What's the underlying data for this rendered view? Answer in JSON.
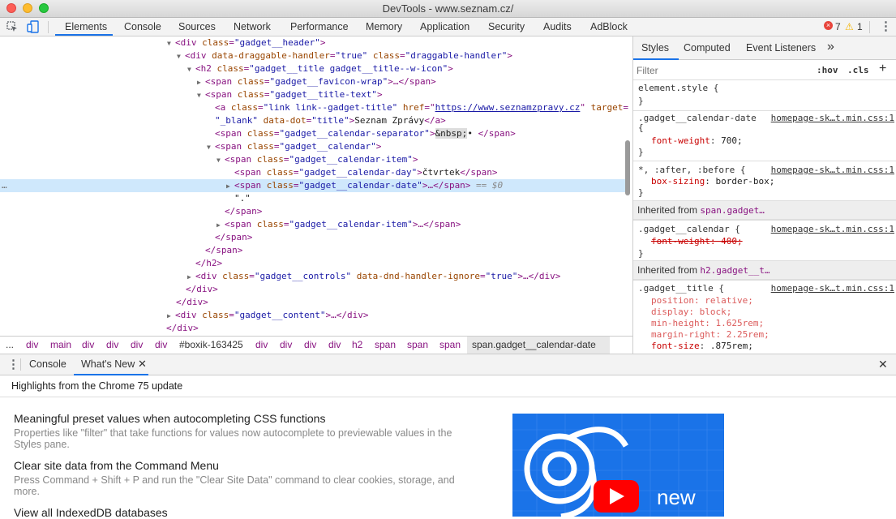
{
  "window": {
    "title": "DevTools - www.seznam.cz/"
  },
  "tabs": [
    "Elements",
    "Console",
    "Sources",
    "Network",
    "Performance",
    "Memory",
    "Application",
    "Security",
    "Audits",
    "AdBlock"
  ],
  "status": {
    "errors": "7",
    "warnings": "1"
  },
  "dom": {
    "l1": {
      "tag": "<div ",
      "a1": "class",
      "v1": "\"gadget__header\"",
      "end": ">"
    },
    "l2": {
      "tag": "<div ",
      "a1": "data-draggable-handler",
      "v1": "\"true\"",
      "a2": "class",
      "v2": "\"draggable-handler\"",
      "end": ">"
    },
    "l3": {
      "tag": "<h2 ",
      "a1": "class",
      "v1": "\"gadget__title gadget__title--w-icon\"",
      "end": ">"
    },
    "l4": {
      "tag": "<span ",
      "a1": "class",
      "v1": "\"gadget__favicon-wrap\"",
      "end": ">…</span>"
    },
    "l5": {
      "tag": "<span ",
      "a1": "class",
      "v1": "\"gadget__title-text\"",
      "end": ">"
    },
    "l6": {
      "tag": "<a ",
      "a1": "class",
      "v1": "\"link link--gadget-title\"",
      "a2": "href",
      "v2": "https://www.seznamzpravy.cz",
      "a3": "target",
      "v3": "\"_blank\"",
      "a4": "data-dot",
      "v4": "\"title\"",
      "text": "Seznam Zprávy",
      "end": "</a>"
    },
    "l8": {
      "tag": "<span ",
      "a1": "class",
      "v1": "\"gadget__calendar-separator\"",
      "entity": "&nbsp;",
      "text": "• ",
      "end": "</span>"
    },
    "l9": {
      "tag": "<span ",
      "a1": "class",
      "v1": "\"gadget__calendar\"",
      "end": ">"
    },
    "l10": {
      "tag": "<span ",
      "a1": "class",
      "v1": "\"gadget__calendar-item\"",
      "end": ">"
    },
    "l11": {
      "tag": "<span ",
      "a1": "class",
      "v1": "\"gadget__calendar-day\"",
      "text": "čtvrtek",
      "end": "</span>"
    },
    "l12": {
      "tag": "<span ",
      "a1": "class",
      "v1": "\"gadget__calendar-date\"",
      "end": ">…</span>",
      "eq": " == $0"
    },
    "l13": {
      "text": "\".\""
    },
    "l14": {
      "end": "</span>"
    },
    "l15": {
      "tag": "<span ",
      "a1": "class",
      "v1": "\"gadget__calendar-item\"",
      "end": ">…</span>"
    },
    "l16": {
      "end": "</span>"
    },
    "l17": {
      "end": "</span>"
    },
    "l18": {
      "end": "</h2>"
    },
    "l19": {
      "tag": "<div ",
      "a1": "class",
      "v1": "\"gadget__controls\"",
      "a2": "data-dnd-handler-ignore",
      "v2": "\"true\"",
      "end": ">…</div>"
    },
    "l20": {
      "end": "</div>"
    },
    "l21": {
      "end": "</div>"
    },
    "l22": {
      "tag": "<div ",
      "a1": "class",
      "v1": "\"gadget__content\"",
      "end": ">…</div>"
    },
    "l23": {
      "end": "</div>"
    }
  },
  "breadcrumbs": [
    "...",
    "div",
    "main",
    "div",
    "div",
    "div",
    "div",
    "#boxik-163425",
    "div",
    "div",
    "div",
    "div",
    "h2",
    "span",
    "span",
    "span",
    "span.gadget__calendar-date"
  ],
  "styles": {
    "tabs": [
      "Styles",
      "Computed",
      "Event Listeners",
      "»"
    ],
    "filter_placeholder": "Filter",
    "hov": ":hov",
    "cls": ".cls",
    "add": "+",
    "element_style": "element.style {",
    "close": "}",
    "r1_sel": ".gadget__calendar-date",
    "r1_src": "homepage-sk…t.min.css:1",
    "r1_prop": "font-weight",
    "r1_val": "700;",
    "r2_sel": "*, :after, :before {",
    "r2_src": "homepage-sk…t.min.css:1",
    "r2_prop": "box-sizing",
    "r2_val": "border-box;",
    "inh1_label": "Inherited from ",
    "inh1_sel": "span.gadget…",
    "r3_sel": ".gadget__calendar {",
    "r3_src": "homepage-sk…t.min.css:1",
    "r3_prop": "font-weight",
    "r3_val": "400;",
    "inh2_label": "Inherited from ",
    "inh2_sel": "h2.gadget__t…",
    "r4_sel": ".gadget__title {",
    "r4_src": "homepage-sk…t.min.css:1",
    "r4_p1": "position",
    "r4_v1": "relative;",
    "r4_p2": "display",
    "r4_v2": "block;",
    "r4_p3": "min-height",
    "r4_v3": "1.625rem;",
    "r4_p4": "margin-right",
    "r4_v4": "2.25rem;",
    "r4_p5": "font-size",
    "r4_v5": ".875rem;"
  },
  "drawer": {
    "tabs": [
      "Console",
      "What's New"
    ],
    "header": "Highlights from the Chrome 75 update",
    "items": [
      {
        "title": "Meaningful preset values when autocompleting CSS functions",
        "desc": "Properties like \"filter\" that take functions for values now autocomplete to previewable values in the Styles pane."
      },
      {
        "title": "Clear site data from the Command Menu",
        "desc": "Press Command + Shift + P and run the \"Clear Site Data\" command to clear cookies, storage, and more."
      },
      {
        "title": "View all IndexedDB databases",
        "desc": ""
      }
    ],
    "promo_text": "new"
  },
  "colors": {
    "accent": "#1a73e8",
    "selection": "#cfe8fc",
    "tag": "#881280",
    "attr": "#994500",
    "value": "#1a1aa6"
  }
}
